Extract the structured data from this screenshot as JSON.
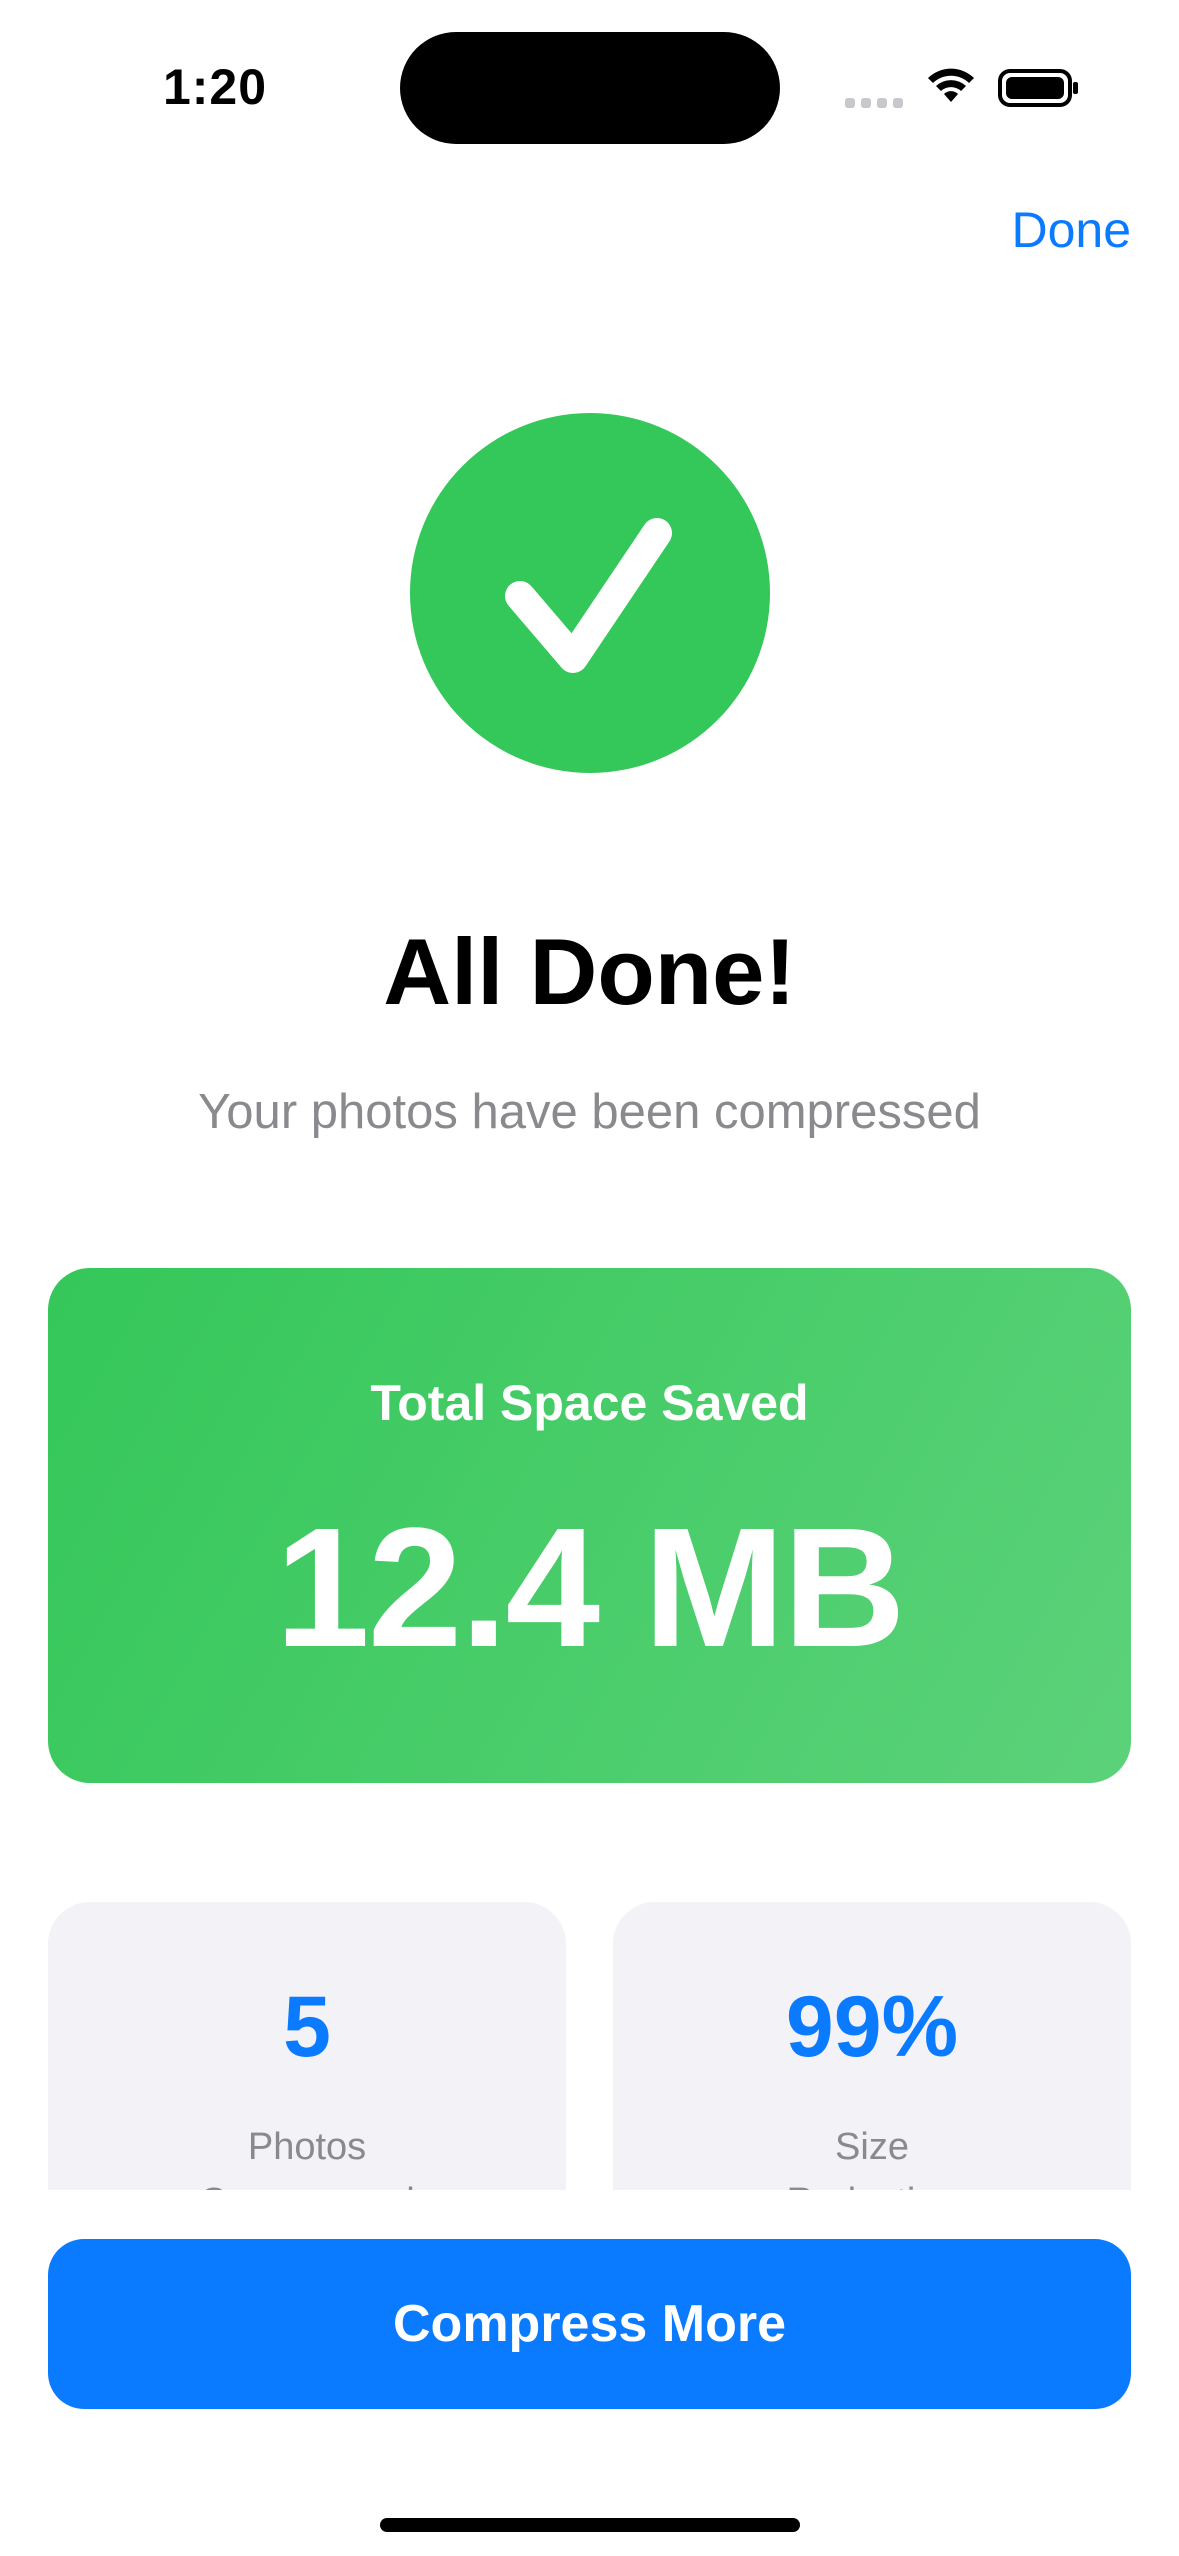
{
  "status_bar": {
    "time": "1:20",
    "icons": [
      "cellular-signal-icon",
      "wifi-icon",
      "battery-icon"
    ]
  },
  "nav": {
    "done_label": "Done"
  },
  "hero": {
    "icon": "checkmark-circle-icon",
    "title": "All Done!",
    "subtitle": "Your photos have been compressed"
  },
  "summary_card": {
    "label": "Total Space Saved",
    "value": "12.4 MB"
  },
  "stats": [
    {
      "value": "5",
      "label": "Photos",
      "label_cutoff": "Compressed"
    },
    {
      "value": "99%",
      "label": "Size",
      "label_cutoff": "Reduction"
    }
  ],
  "actions": {
    "primary_label": "Compress More"
  },
  "colors": {
    "accent_blue": "#0A7AFF",
    "success_green": "#34C759",
    "secondary_text": "#8A8A8E",
    "card_background": "#F2F2F7"
  }
}
